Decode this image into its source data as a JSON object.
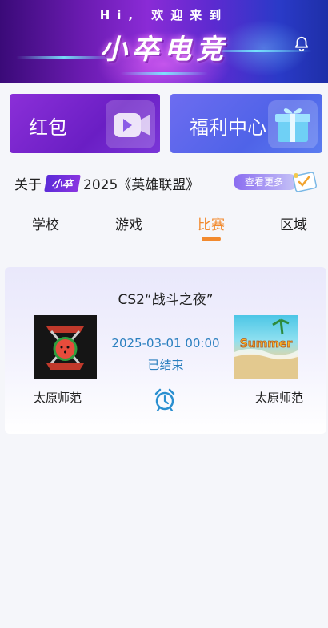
{
  "header": {
    "greeting": "Hi, 欢迎来到",
    "brand": "小卒电竞",
    "notification_icon": "bell-icon"
  },
  "cards": [
    {
      "label": "红包",
      "icon": "video-camera-icon"
    },
    {
      "label": "福利中心",
      "icon": "gift-icon"
    }
  ],
  "notice": {
    "prefix": "关于",
    "tag": "小卒",
    "text": "2025《英雄联盟》",
    "more_label": "查看更多"
  },
  "tabs": [
    {
      "label": "学校",
      "active": false
    },
    {
      "label": "游戏",
      "active": false
    },
    {
      "label": "比赛",
      "active": true
    },
    {
      "label": "区域",
      "active": false
    }
  ],
  "match": {
    "title": "CS2“战斗之夜”",
    "time": "2025-03-01 00:00",
    "status": "已结束",
    "team_left": "太原师范",
    "team_right": "太原师范",
    "logo_right_text": "Summer",
    "clock_icon": "alarm-clock-icon"
  },
  "colors": {
    "accent": "#f28a2e",
    "time_blue": "#2a7fbf",
    "card_red": "#7a2ad0",
    "card_welfare": "#5a6cf0"
  }
}
